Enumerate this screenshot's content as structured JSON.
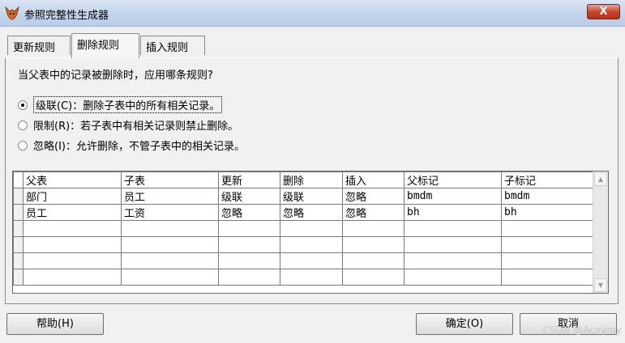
{
  "window": {
    "title": "参照完整性生成器",
    "close_glyph": "X"
  },
  "tabs": [
    {
      "label": "更新规则",
      "active": false
    },
    {
      "label": "删除规则",
      "active": true
    },
    {
      "label": "插入规则",
      "active": false
    }
  ],
  "question": "当父表中的记录被删除时，应用哪条规则?",
  "options": [
    {
      "label": "级联(C)：删除子表中的所有相关记录。",
      "selected": true
    },
    {
      "label": "限制(R)：若子表中有相关记录则禁止删除。",
      "selected": false
    },
    {
      "label": "忽略(I)：允许删除，不管子表中的相关记录。",
      "selected": false
    }
  ],
  "grid": {
    "headers": [
      "父表",
      "子表",
      "更新",
      "删除",
      "插入",
      "父标记",
      "子标记"
    ],
    "rows": [
      [
        "部门",
        "员工",
        "级联",
        "级联",
        "忽略",
        "bmdm",
        "bmdm"
      ],
      [
        "员工",
        "工资",
        "忽略",
        "忽略",
        "忽略",
        "bh",
        "bh"
      ],
      [
        "",
        "",
        "",
        "",
        "",
        "",
        ""
      ],
      [
        "",
        "",
        "",
        "",
        "",
        "",
        ""
      ],
      [
        "",
        "",
        "",
        "",
        "",
        "",
        ""
      ],
      [
        "",
        "",
        "",
        "",
        "",
        "",
        ""
      ]
    ]
  },
  "buttons": {
    "help": "帮助(H)",
    "ok": "确定(O)",
    "cancel": "取消"
  },
  "watermark": "CSDN @Acxymy"
}
